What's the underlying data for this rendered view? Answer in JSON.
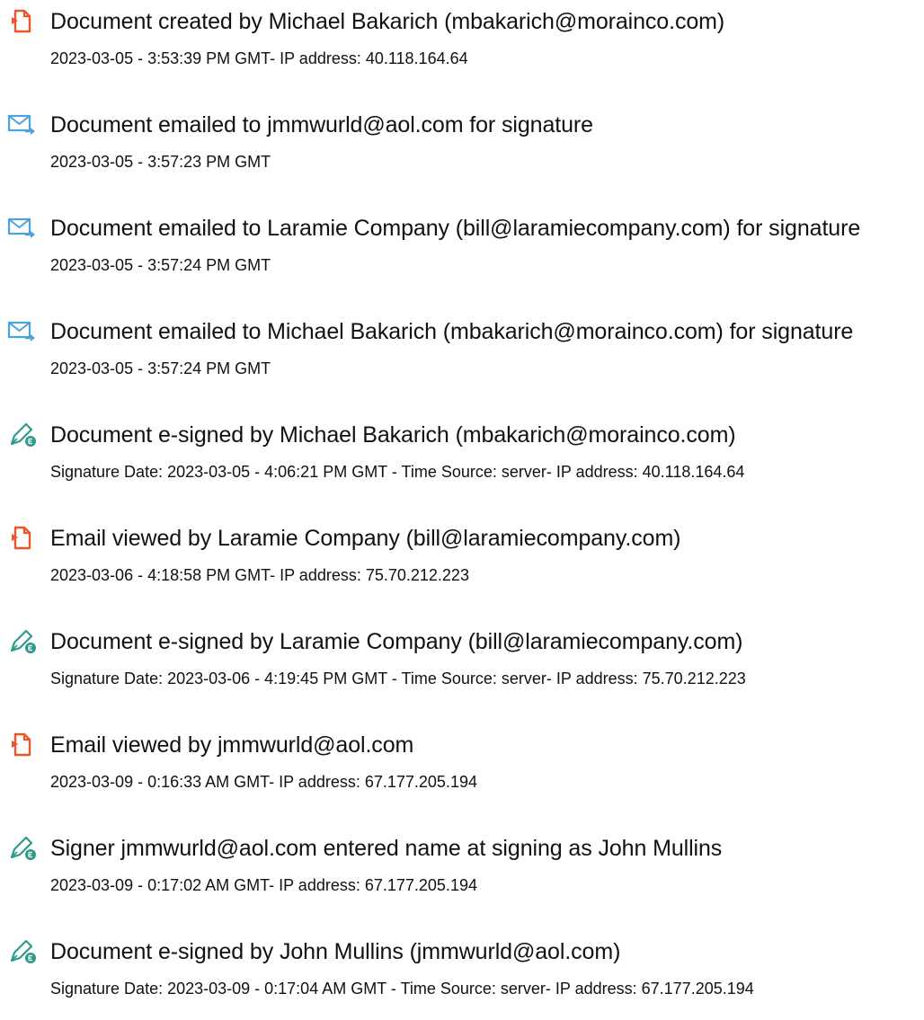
{
  "colors": {
    "pdf": "#e8562a",
    "email": "#4aa3df",
    "sign": "#2e9a8c",
    "text": "#111111"
  },
  "entries": [
    {
      "icon": "pdf-document-icon",
      "title": "Document created by Michael Bakarich (mbakarich@morainco.com)",
      "detail": "2023-03-05 - 3:53:39 PM GMT- IP address: 40.118.164.64"
    },
    {
      "icon": "email-send-icon",
      "title": "Document emailed to jmmwurld@aol.com for signature",
      "detail": "2023-03-05 - 3:57:23 PM GMT"
    },
    {
      "icon": "email-send-icon",
      "title": "Document emailed to Laramie Company (bill@laramiecompany.com) for signature",
      "detail": "2023-03-05 - 3:57:24 PM GMT"
    },
    {
      "icon": "email-send-icon",
      "title": "Document emailed to Michael Bakarich (mbakarich@morainco.com) for signature",
      "detail": "2023-03-05 - 3:57:24 PM GMT"
    },
    {
      "icon": "e-sign-pen-icon",
      "title": "Document e-signed by Michael Bakarich (mbakarich@morainco.com)",
      "detail": "Signature Date: 2023-03-05 - 4:06:21 PM GMT - Time Source: server- IP address: 40.118.164.64"
    },
    {
      "icon": "pdf-document-icon",
      "title": "Email viewed by Laramie Company (bill@laramiecompany.com)",
      "detail": "2023-03-06 - 4:18:58 PM GMT- IP address: 75.70.212.223"
    },
    {
      "icon": "e-sign-pen-icon",
      "title": "Document e-signed by Laramie Company (bill@laramiecompany.com)",
      "detail": "Signature Date: 2023-03-06 - 4:19:45 PM GMT - Time Source: server- IP address: 75.70.212.223"
    },
    {
      "icon": "pdf-document-icon",
      "title": "Email viewed by jmmwurld@aol.com",
      "detail": "2023-03-09 - 0:16:33 AM GMT- IP address: 67.177.205.194"
    },
    {
      "icon": "e-sign-pen-icon",
      "title": "Signer jmmwurld@aol.com entered name at signing as John Mullins",
      "detail": "2023-03-09 - 0:17:02 AM GMT- IP address: 67.177.205.194"
    },
    {
      "icon": "e-sign-pen-icon",
      "title": "Document e-signed by John Mullins (jmmwurld@aol.com)",
      "detail": "Signature Date: 2023-03-09 - 0:17:04 AM GMT - Time Source: server- IP address: 67.177.205.194"
    }
  ]
}
